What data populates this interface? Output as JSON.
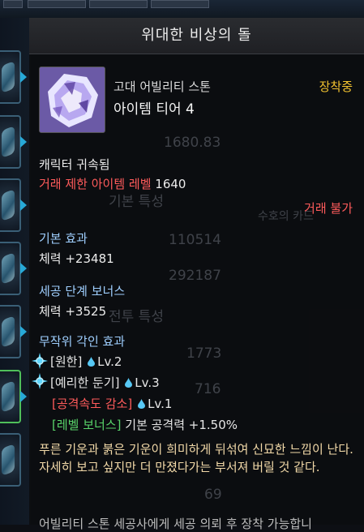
{
  "tooltip": {
    "title": "위대한 비상의 돌",
    "item_type": "고대 어빌리티 스톤",
    "equipped_label": "장착중",
    "tier": "아이템 티어 4",
    "bound": "캐릭터 귀속됨",
    "trade_limit_label": "거래 제한 아이템 레벨",
    "trade_limit_value": "1640",
    "trade_status": "거래 불가",
    "basic_effect_header": "기본 효과",
    "basic_effect_value": "체력 +23481",
    "bonus_header": "세공 단계 보너스",
    "bonus_value": "체력 +3525",
    "engraving_header": "무작위 각인 효과",
    "engravings": [
      {
        "name": "[원한]",
        "level": "Lv.2",
        "color": "#ececec"
      },
      {
        "name": "[예리한 둔기]",
        "level": "Lv.3",
        "color": "#ececec"
      },
      {
        "name": "[공격속도 감소]",
        "level": "Lv.1",
        "color": "#ff5b5b"
      }
    ],
    "level_bonus_label": "[레벨 보너스]",
    "level_bonus_text": "기본 공격력 +1.50%",
    "description": "푸른 기운과 붉은 기운이 희미하게 뒤섞여 신묘한 느낌이 난다. 자세히 보고 싶지만 더 만졌다가는 부서져 버릴 것 같다.",
    "footer_text": "어빌리티 스톤 세공사에게 세공 의뢰 후 장착 가능합니"
  },
  "background": {
    "ghost_texts": [
      "1680.83",
      "기본 특성",
      "110514",
      "292187",
      "전투 특성",
      "1773",
      "716",
      "69",
      "수호의 카드"
    ]
  },
  "colors": {
    "equipped": "#f2c230",
    "warning": "#ff5b5b",
    "header": "#9fcfff",
    "level_bonus": "#59d46a",
    "description": "#f2d9a8"
  }
}
